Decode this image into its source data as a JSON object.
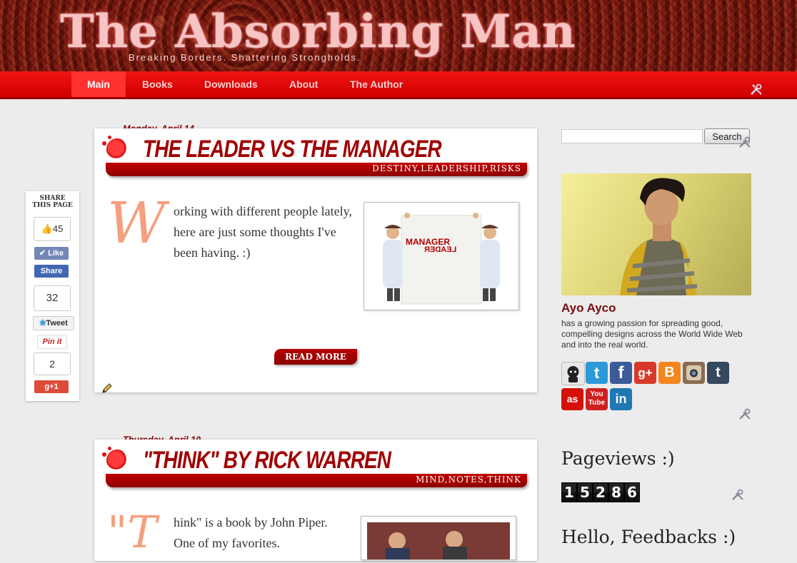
{
  "site": {
    "title": "The Absorbing Man",
    "tagline": "Breaking Borders. Shattering Strongholds."
  },
  "nav": {
    "items": [
      {
        "label": "Main",
        "active": true
      },
      {
        "label": "Books",
        "active": false
      },
      {
        "label": "Downloads",
        "active": false
      },
      {
        "label": "About",
        "active": false
      },
      {
        "label": "The Author",
        "active": false
      }
    ],
    "tools_icon": "wrench-screwdriver-icon"
  },
  "share": {
    "heading_line1": "SHARE",
    "heading_line2": "THIS PAGE",
    "fb_count": "45",
    "like_label": "Like",
    "share_label": "Share",
    "tweet_count": "32",
    "tweet_label": "Tweet",
    "pin_label": "Pin it",
    "plus_count": "2",
    "plus_label": "g+1"
  },
  "posts": [
    {
      "date": "Monday, April 14",
      "title": "The Leader vs the Manager",
      "tags": "DESTINY,LEADERSHIP,RISKS",
      "dropcap": "W",
      "text": "orking with different people lately, here are just some thoughts I've been having. :)",
      "image_text_top": "MANAGER",
      "image_text_bottom": "LEADER",
      "read_more": "READ MORE"
    },
    {
      "date": "Thursday, April 10",
      "title": "\"Think\" by Rick Warren",
      "tags": "MIND,NOTES,THINK",
      "dropcap": "\"T",
      "text": "hink\" is a book by John Piper. One of my favorites."
    }
  ],
  "sidebar": {
    "search_placeholder": "",
    "search_button": "Search",
    "profile_name": "Ayo Ayco",
    "profile_bio": "has a growing passion for spreading good, compelling designs across the World Wide Web and into the real world.",
    "social": [
      {
        "icon": "github-octocat-icon",
        "color": "#e8e8e8"
      },
      {
        "icon": "twitter-icon",
        "color": "#2c9ad8"
      },
      {
        "icon": "facebook-icon",
        "color": "#3b5b98"
      },
      {
        "icon": "google-plus-icon",
        "color": "#d73a2b"
      },
      {
        "icon": "blogger-icon",
        "color": "#f4861d"
      },
      {
        "icon": "instagram-icon",
        "color": "#8a6c53"
      },
      {
        "icon": "tumblr-icon",
        "color": "#34495e"
      },
      {
        "icon": "lastfm-icon",
        "color": "#d51007"
      },
      {
        "icon": "youtube-icon",
        "color": "#cf2020"
      },
      {
        "icon": "linkedin-icon",
        "color": "#1f78b4"
      }
    ],
    "pageviews_title": "Pageviews :)",
    "pageviews_digits": [
      "1",
      "5",
      "2",
      "8",
      "6"
    ],
    "feedback_title": "Hello, Feedbacks :)"
  }
}
